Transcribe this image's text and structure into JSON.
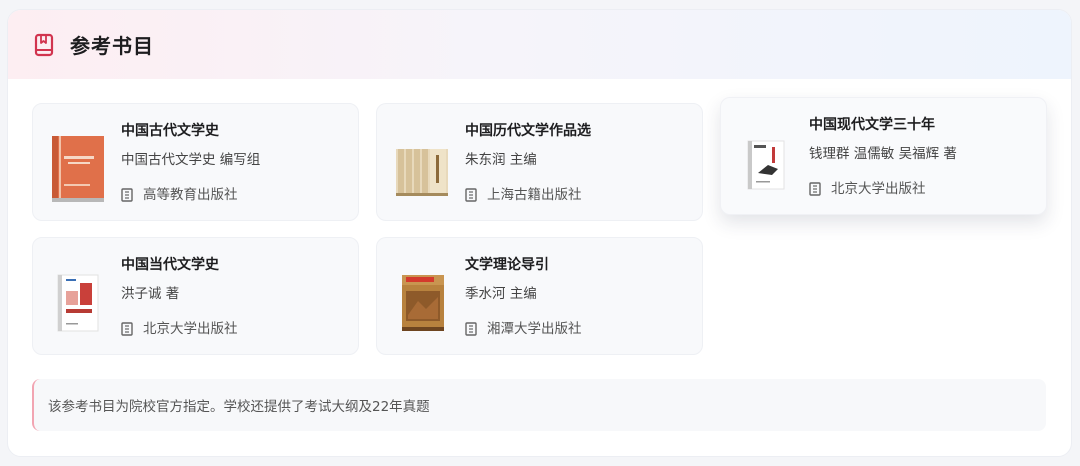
{
  "header": {
    "title": "参考书目",
    "icon": "book-icon",
    "accent": "#d1344f"
  },
  "books": [
    {
      "title": "中国古代文学史",
      "author": "中国古代文学史 编写组",
      "publisher": "高等教育出版社",
      "cover_color": "#e0704a"
    },
    {
      "title": "中国历代文学作品选",
      "author": "朱东润 主编",
      "publisher": "上海古籍出版社",
      "cover_color": "#e4d2b0"
    },
    {
      "title": "中国现代文学三十年",
      "author": "钱理群 温儒敏 吴福辉 著",
      "publisher": "北京大学出版社",
      "cover_color": "#ffffff"
    },
    {
      "title": "中国当代文学史",
      "author": "洪子诚 著",
      "publisher": "北京大学出版社",
      "cover_color": "#ffffff"
    },
    {
      "title": "文学理论导引",
      "author": "季水河 主编",
      "publisher": "湘潭大学出版社",
      "cover_color": "#b8823e"
    }
  ],
  "publisher_icon": "building-icon",
  "note": {
    "text": "该参考书目为院校官方指定。学校还提供了考试大纲及22年真题",
    "accent": "#f2a5b2"
  }
}
